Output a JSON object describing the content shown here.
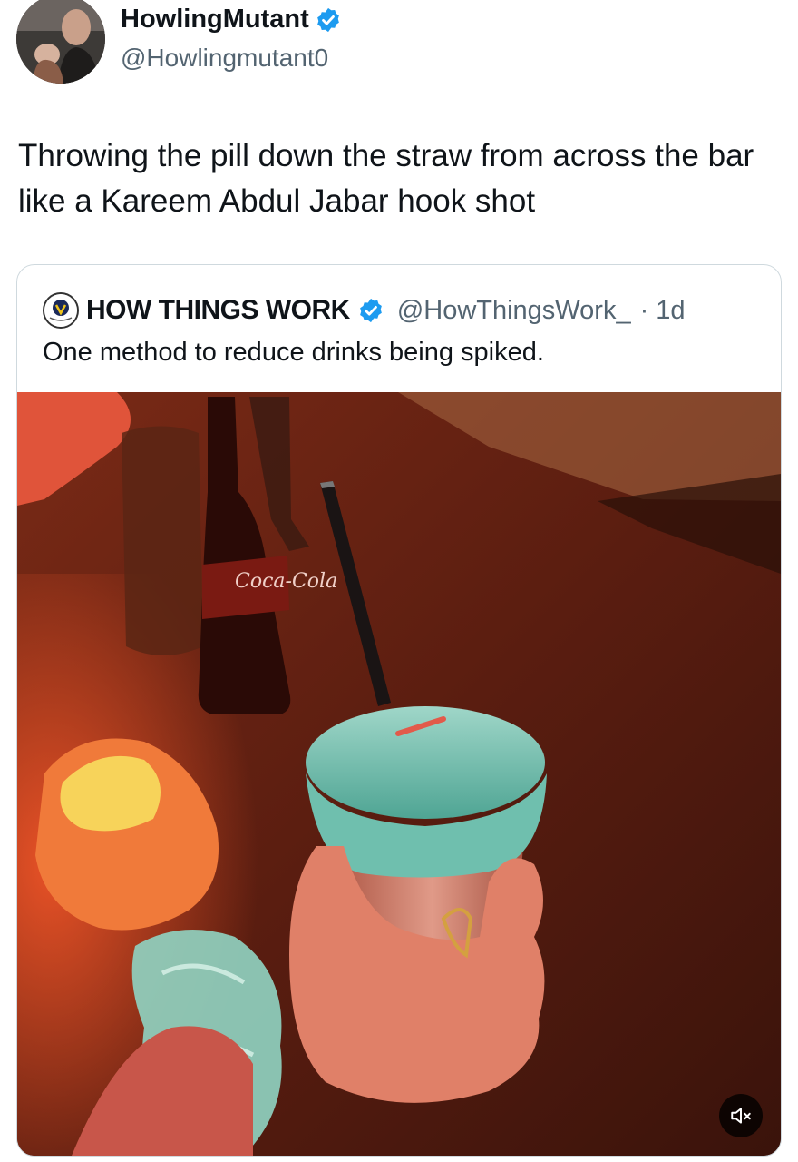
{
  "tweet": {
    "author_name": "HowlingMutant",
    "author_handle": "@Howlingmutant0",
    "text": "Throwing the pill down the straw from across the bar like a Kareem Abdul Jabar hook shot"
  },
  "quote": {
    "author_name": "HOW THINGS WORK",
    "author_handle": "@HowThingsWork_",
    "time": "· 1d",
    "text": "One method to reduce drinks being spiked."
  },
  "media": {
    "bottle_label": "Coca-Cola",
    "mute_icon": "speaker-muted-icon"
  },
  "colors": {
    "verified_blue": "#1d9bf0",
    "handle_gray": "#536471",
    "text": "#0f1419"
  }
}
